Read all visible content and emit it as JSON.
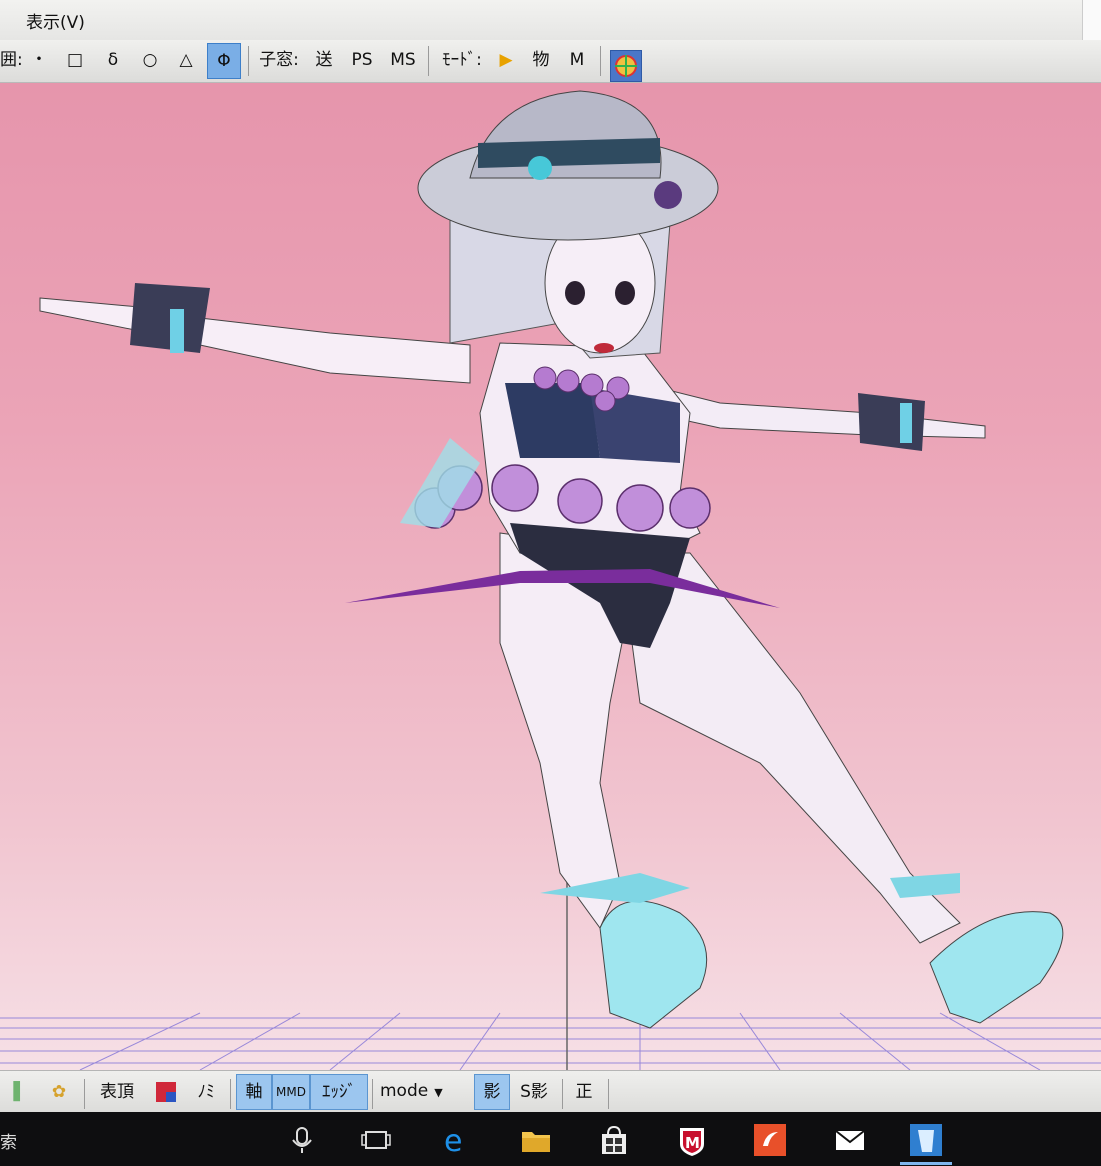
{
  "menubar": {
    "view_menu": "表示(V)"
  },
  "toolbar": {
    "range_label": "囲:",
    "sel_dot": "・",
    "sel_square": "□",
    "sel_delta": "δ",
    "sel_circle": "○",
    "sel_triangle": "△",
    "sel_phi": "Φ",
    "child_window_label": "子窓:",
    "send": "送",
    "ps": "PS",
    "ms": "MS",
    "mode_label": "ﾓｰﾄﾞ:",
    "obj": "物",
    "m": "M"
  },
  "bottombar": {
    "vertex": "表頂",
    "normal": "ﾉﾐ",
    "axis": "軸",
    "mmd": "MMD",
    "edge": "ｴｯｼﾞ",
    "mode": "mode",
    "shadow": "影",
    "s_shadow": "S影",
    "front": "正"
  },
  "taskbar": {
    "search_stub": "索"
  },
  "colors": {
    "viewport_top": "#e695ac",
    "viewport_bottom": "#f6e0e6",
    "grid": "#7a6cd6",
    "active_button": "#7aaee6",
    "taskbar": "#0e0e10"
  }
}
